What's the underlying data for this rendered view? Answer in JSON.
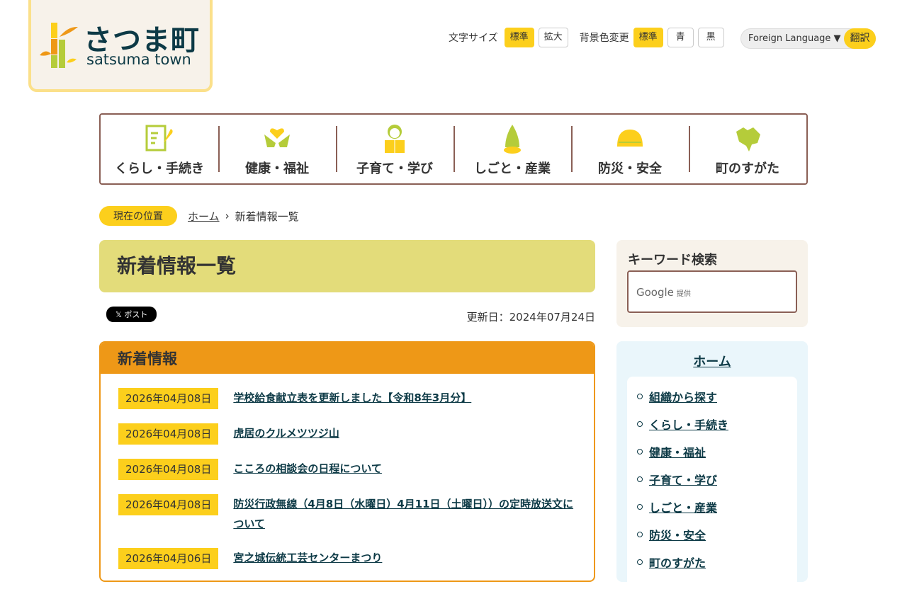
{
  "logo": {
    "jp": "さつま町",
    "en": "satsuma town"
  },
  "util": {
    "font_size_label": "文字サイズ",
    "font_std": "標準",
    "font_large": "拡大",
    "bg_label": "背景色変更",
    "bg_std": "標準",
    "bg_blue": "青",
    "bg_black": "黒",
    "lang": "Foreign Language ▼",
    "translate": "翻訳"
  },
  "gnav": [
    {
      "label": "くらし・手続き",
      "icon": "document-pen-icon"
    },
    {
      "label": "健康・福祉",
      "icon": "heart-hands-icon"
    },
    {
      "label": "子育て・学び",
      "icon": "child-reading-icon"
    },
    {
      "label": "しごと・産業",
      "icon": "bamboo-shoot-icon"
    },
    {
      "label": "防災・安全",
      "icon": "helmet-icon"
    },
    {
      "label": "町のすがた",
      "icon": "town-map-icon"
    }
  ],
  "breadcrumb": {
    "here": "現在の位置",
    "home": "ホーム",
    "sep": "›",
    "current": "新着情報一覧"
  },
  "page_title": "新着情報一覧",
  "xpost": "𝕏 ポスト",
  "updated": "更新日：2024年07月24日",
  "news": {
    "heading": "新着情報",
    "items": [
      {
        "date": "2026年04月08日",
        "title": "学校給食献立表を更新しました【令和8年3月分】"
      },
      {
        "date": "2026年04月08日",
        "title": "虎居のクルメツツジ山"
      },
      {
        "date": "2026年04月08日",
        "title": "こころの相談会の日程について"
      },
      {
        "date": "2026年04月08日",
        "title": "防災行政無線（4月8日（水曜日）4月11日（土曜日））の定時放送文について"
      },
      {
        "date": "2026年04月06日",
        "title": "宮之城伝統工芸センターまつり"
      }
    ]
  },
  "search": {
    "title": "キーワード検索",
    "google": "Google",
    "provided": "提供"
  },
  "side": {
    "home": "ホーム",
    "items": [
      "組織から探す",
      "くらし・手続き",
      "健康・福祉",
      "子育て・学び",
      "しごと・産業",
      "防災・安全",
      "町のすがた"
    ]
  }
}
